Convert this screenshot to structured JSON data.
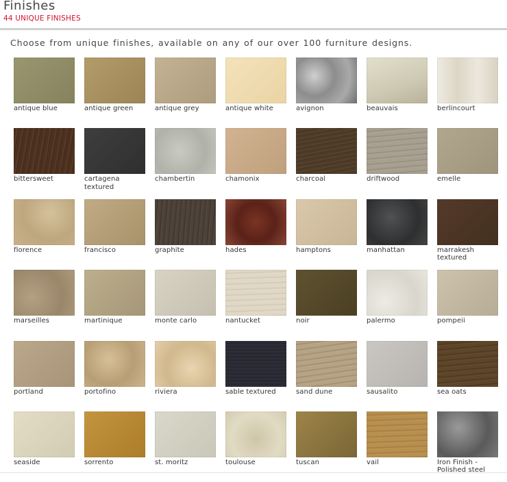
{
  "header": {
    "title": "Finishes",
    "count": "44 UNIQUE FINISHES",
    "intro": "Choose from unique finishes, available on any of our over 100 furniture designs."
  },
  "finishes": [
    {
      "label": "antique blue",
      "color": "#8f8a66",
      "bg": "linear-gradient(135deg,#9a9670,#86825d)"
    },
    {
      "label": "antique green",
      "color": "#a89060",
      "bg": "linear-gradient(135deg,#b39c6a,#9c8456)"
    },
    {
      "label": "antique grey",
      "color": "#b9a789",
      "bg": "linear-gradient(135deg,#c3b293,#ad9c7e)"
    },
    {
      "label": "antique white",
      "color": "#f0dcb0",
      "bg": "linear-gradient(135deg,#f4e2ba,#ead4a5)"
    },
    {
      "label": "avignon",
      "color": "#9a9a9a",
      "bg": "radial-gradient(circle at 30% 40%,#cfcfcf 0,#8d8d8d 40%,#a9a9a9 70%,#6e6e6e 100%)"
    },
    {
      "label": "beauvais",
      "color": "#d6d2bd",
      "bg": "linear-gradient(160deg,#e2dfcc 0%,#cdc9b2 60%,#b9b29a 100%)"
    },
    {
      "label": "berlincourt",
      "color": "#e7e3d6",
      "bg": "linear-gradient(90deg,#eeeae0,#dcd6c6,#ece8dd,#d8d2c2)"
    },
    {
      "label": "bittersweet",
      "color": "#4a3020",
      "bg": "repeating-linear-gradient(100deg,#4b3020 0,#4b3020 4px,#5e3d28 5px,#3d2717 8px)"
    },
    {
      "label": "cartagena textured",
      "color": "#383838",
      "bg": "linear-gradient(135deg,#3e3e3e,#2f2f2f)"
    },
    {
      "label": "chambertin",
      "color": "#bdbfb7",
      "bg": "radial-gradient(circle at 40% 50%,#c9cbc3 0,#b0b2aa 60%,#c3c5bd 100%)"
    },
    {
      "label": "chamonix",
      "color": "#c9a987",
      "bg": "linear-gradient(135deg,#d2b391,#bfa07d)"
    },
    {
      "label": "charcoal",
      "color": "#4c3a28",
      "bg": "repeating-linear-gradient(170deg,#4d3b28 0,#4d3b28 3px,#5d4832 4px,#3f2f1f 6px)"
    },
    {
      "label": "driftwood",
      "color": "#a29a8a",
      "bg": "repeating-linear-gradient(175deg,#a79f8f 0,#a79f8f 4px,#958d7d 5px,#b0a898 8px)"
    },
    {
      "label": "emelle",
      "color": "#a99e86",
      "bg": "linear-gradient(135deg,#b1a78f,#9f957d)"
    },
    {
      "label": "florence",
      "color": "#c7b18c",
      "bg": "radial-gradient(circle at 60% 30%,#d4c19c 0,#bea77f 55%,#c9b08b 100%)"
    },
    {
      "label": "francisco",
      "color": "#b6a079",
      "bg": "linear-gradient(135deg,#c1ab84,#a8926b)"
    },
    {
      "label": "graphite",
      "color": "#4a4037",
      "bg": "repeating-linear-gradient(95deg,#4d4239 0,#4d4239 3px,#3e352d 4px,#574c42 7px)"
    },
    {
      "label": "hades",
      "color": "#6b2a1e",
      "bg": "radial-gradient(circle at 50% 50%,#7a3325 0,#5a2218 50%,#8a4536 100%)"
    },
    {
      "label": "hamptons",
      "color": "#d4c1a3",
      "bg": "linear-gradient(135deg,#dac8aa,#c8b596)"
    },
    {
      "label": "manhattan",
      "color": "#3a3b3c",
      "bg": "radial-gradient(circle at 40% 40%,#4f5152 0,#2e2f30 60%,#444 100%)"
    },
    {
      "label": "marrakesh textured",
      "color": "#4d3627",
      "bg": "linear-gradient(135deg,#55392a,#43301f)"
    },
    {
      "label": "marseilles",
      "color": "#a89577",
      "bg": "radial-gradient(circle at 30% 60%,#b39f82 0,#9a876a 60%,#ae9b7e 100%)"
    },
    {
      "label": "martinique",
      "color": "#b3a482",
      "bg": "linear-gradient(135deg,#bdaf8d,#a59677)"
    },
    {
      "label": "monte carlo",
      "color": "#d0cbbb",
      "bg": "linear-gradient(135deg,#d8d3c4,#c5c0b0)"
    },
    {
      "label": "nantucket",
      "color": "#ddd4c1",
      "bg": "repeating-linear-gradient(178deg,#e0d8c6 0,#e0d8c6 4px,#d2c9b5 5px,#e6decc 8px)"
    },
    {
      "label": "noir",
      "color": "#574b2a",
      "bg": "linear-gradient(135deg,#5f5230,#4a3f22)"
    },
    {
      "label": "palermo",
      "color": "#e4e2d9",
      "bg": "radial-gradient(circle at 30% 70%,#ecebe4 0,#d9d6cc 60%,#e8e6de 100%)"
    },
    {
      "label": "pompeii",
      "color": "#c4b9a3",
      "bg": "linear-gradient(135deg,#cdc3ad,#b7ac95)"
    },
    {
      "label": "portland",
      "color": "#b39f82",
      "bg": "linear-gradient(135deg,#bba88b,#a89478)"
    },
    {
      "label": "portofino",
      "color": "#c9b089",
      "bg": "radial-gradient(circle at 40% 40%,#d6bf98 0,#b89e74 55%,#cdb48e 100%)"
    },
    {
      "label": "riviera",
      "color": "#dfc9a1",
      "bg": "radial-gradient(circle at 60% 60%,#e8d5b0 0,#d1b88d 55%,#e3ceaa 100%)"
    },
    {
      "label": "sable textured",
      "color": "#2a2a34",
      "bg": "repeating-linear-gradient(180deg,#2d2d38 0,#2d2d38 2px,#23232b 3px,#30303b 5px)"
    },
    {
      "label": "sand dune",
      "color": "#b09b7d",
      "bg": "repeating-linear-gradient(172deg,#b6a284 0,#b6a284 4px,#a18d70 5px,#bda98b 8px)"
    },
    {
      "label": "sausalito",
      "color": "#c2bfbb",
      "bg": "linear-gradient(135deg,#cac7c3,#b7b4b0)"
    },
    {
      "label": "sea oats",
      "color": "#5a4227",
      "bg": "repeating-linear-gradient(175deg,#5d4529 0,#5d4529 4px,#4b361f 5px,#6a4f30 8px)"
    },
    {
      "label": "seaside",
      "color": "#ddd7bf",
      "bg": "linear-gradient(135deg,#e3ddc6,#d2ccb4)"
    },
    {
      "label": "sorrento",
      "color": "#bd8c35",
      "bg": "linear-gradient(135deg,#c4953f,#ac7d2a)"
    },
    {
      "label": "st. moritz",
      "color": "#d4d2c3",
      "bg": "linear-gradient(135deg,#dad8ca,#c9c7b8)"
    },
    {
      "label": "toulouse",
      "color": "#d9d2b9",
      "bg": "radial-gradient(circle at 50% 60%,#cfc6a8 0,#e1dbc4 60%,#d3cbb0 100%)"
    },
    {
      "label": "tuscan",
      "color": "#8c7540",
      "bg": "linear-gradient(135deg,#9d8449,#7a6636)"
    },
    {
      "label": "vail",
      "color": "#b38a4a",
      "bg": "repeating-linear-gradient(178deg,#b88f4e 0,#b88f4e 4px,#a57d40 5px,#c19855 8px)"
    },
    {
      "label": "Iron Finish - Polished steel",
      "color": "#6e6e6e",
      "bg": "radial-gradient(circle at 35% 35%,#9a9a9a 0,#5a5a5a 60%,#7a7a7a 100%)"
    }
  ]
}
